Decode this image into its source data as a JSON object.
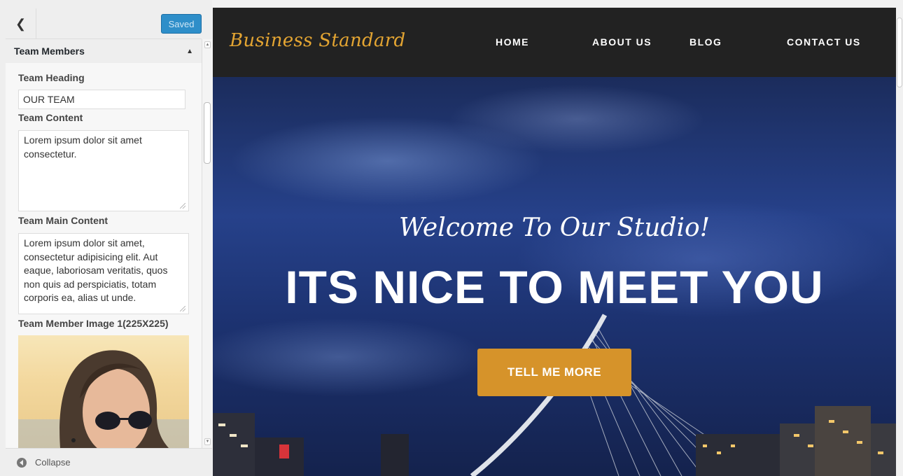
{
  "customizer": {
    "saved_label": "Saved",
    "section_title": "Team Members",
    "controls": {
      "team_heading_label": "Team Heading",
      "team_heading_value": "OUR TEAM",
      "team_content_label": "Team Content",
      "team_content_value": "Lorem ipsum dolor sit amet consectetur.",
      "team_main_content_label": "Team Main Content",
      "team_main_content_value": "Lorem ipsum dolor sit amet, consectetur adipisicing elit. Aut eaque, laboriosam veritatis, quos non quis ad perspiciatis, totam corporis ea, alias ut unde.",
      "team_member_image_label": "Team Member Image 1(225X225)"
    },
    "collapse_label": "Collapse"
  },
  "preview": {
    "brand": "Business Standard",
    "nav": [
      "HOME",
      "ABOUT US",
      "BLOG",
      "CONTACT US"
    ],
    "hero_subtitle": "Welcome To Our Studio!",
    "hero_title": "ITS NICE TO MEET YOU",
    "hero_button": "TELL ME MORE"
  },
  "colors": {
    "saved_button": "#2e8ec9",
    "navbar": "#222222",
    "brand": "#e4a532",
    "hero_button": "#d6932a"
  }
}
